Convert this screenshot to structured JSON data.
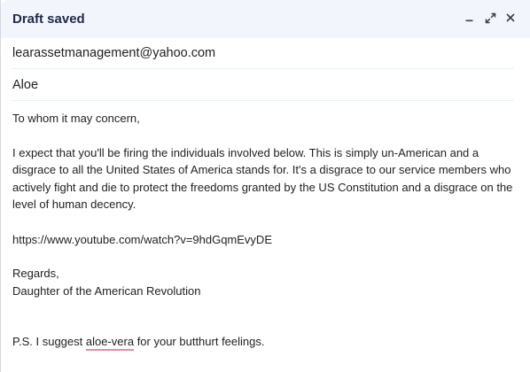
{
  "window": {
    "title": "Draft saved",
    "controls": {
      "minimize": "minimize-icon",
      "expand": "expand-icon",
      "close": "close-icon"
    }
  },
  "compose": {
    "to": "learassetmanagement@yahoo.com",
    "subject": "Aloe",
    "body": {
      "greeting": "To whom it may concern,",
      "paragraph1": "I expect that you'll be firing the individuals involved below. This is simply un-American and a disgrace to all the United States of America stands for. It's a disgrace to our service members who actively fight and die to protect the freedoms granted by the US Constitution and a disgrace on the level of human decency.",
      "link": "https://www.youtube.com/watch?v=9hdGqmEvyDE",
      "closing": "Regards,",
      "signature": "Daughter of the American Revolution",
      "ps_before": "P.S. I suggest ",
      "ps_flagged_word": "aloe-vera",
      "ps_after": " for your butthurt feelings."
    }
  },
  "colors": {
    "titlebar_bg": "#f2f6fc",
    "spellcheck_underline": "#e88aa1"
  }
}
